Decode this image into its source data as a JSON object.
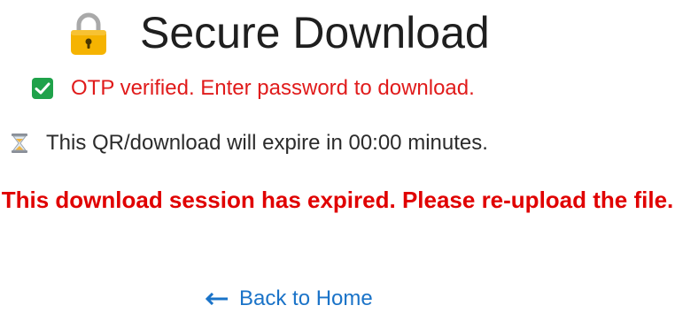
{
  "header": {
    "title": "Secure Download",
    "icon": "lock-icon"
  },
  "otp_status": {
    "text": "OTP verified. Enter password to download.",
    "icon": "check-icon",
    "color": "#e01b1b"
  },
  "expiry": {
    "text": "This QR/download will expire in 00:00 minutes.",
    "icon": "hourglass-icon"
  },
  "expired_message": {
    "text": "This download session has expired. Please re-upload the file.",
    "color": "#e00000"
  },
  "back_link": {
    "label": "Back to Home",
    "icon": "arrow-left-icon",
    "color": "#1a73c8"
  }
}
